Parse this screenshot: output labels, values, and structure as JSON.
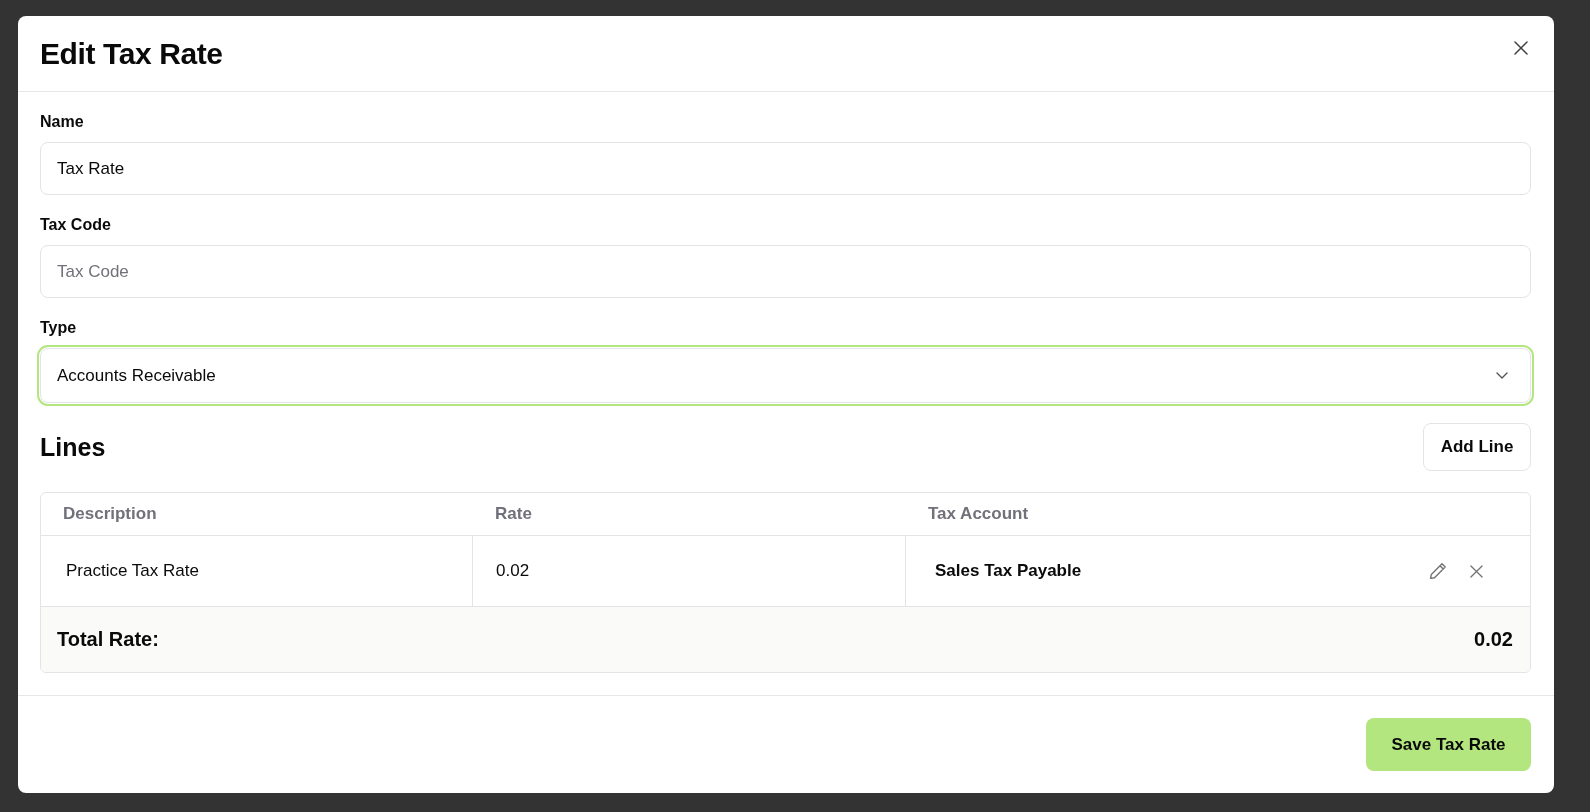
{
  "dialog": {
    "title": "Edit Tax Rate"
  },
  "fields": [
    {
      "kind": "text",
      "label": "Name",
      "value": "Tax Rate",
      "focused": false
    },
    {
      "kind": "text",
      "label": "Tax Code",
      "placeholder": "Tax Code",
      "focused": false
    },
    {
      "kind": "select",
      "label": "Type",
      "value": "Accounts Receivable",
      "focused": true
    }
  ],
  "lines": {
    "title": "Lines",
    "add_button": "Add Line",
    "columns": [
      "Description",
      "Rate",
      "Tax Account"
    ],
    "rows": [
      {
        "cells": [
          "Practice Tax Rate",
          "0.02",
          "Sales Tax Payable"
        ]
      }
    ],
    "total": {
      "label": "Total Rate:",
      "value": "0.02"
    }
  },
  "footer": {
    "save_button": "Save Tax Rate"
  }
}
